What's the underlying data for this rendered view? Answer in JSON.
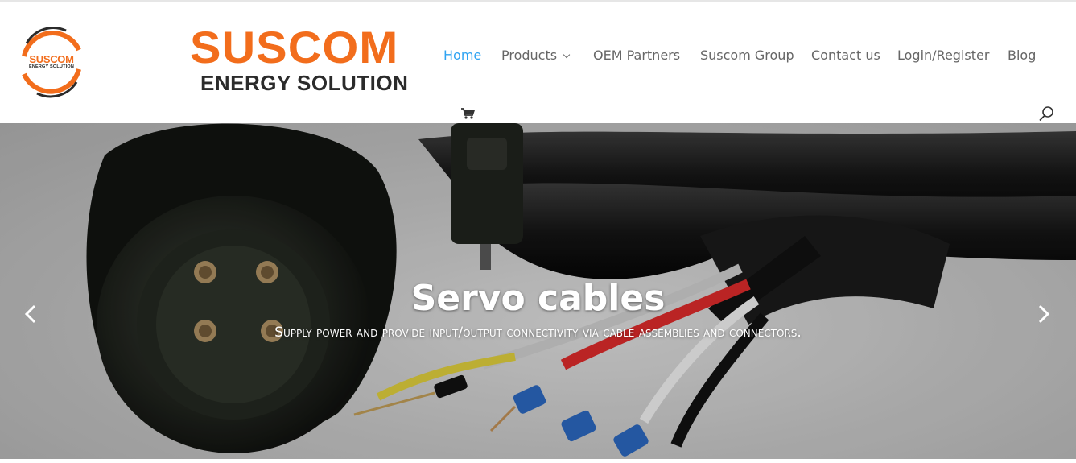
{
  "brand": {
    "badge_title": "SUSCOM",
    "badge_subtitle": "ENERGY SOLUTION",
    "wordmark_title": "SUSCOM",
    "wordmark_subtitle": "ENERGY SOLUTION",
    "orange": "#f26d1c",
    "dark": "#2b2b2b"
  },
  "nav": {
    "items": [
      {
        "label": "Home",
        "active": true
      },
      {
        "label": "Products",
        "has_dropdown": true
      },
      {
        "label": "OEM Partners"
      },
      {
        "label": "Suscom Group"
      },
      {
        "label": "Contact us"
      },
      {
        "label": "Login/Register"
      },
      {
        "label": "Blog"
      }
    ],
    "active_color": "#2ea3f2",
    "text_color": "#666666",
    "icons": [
      "cart-icon",
      "search-icon"
    ]
  },
  "hero": {
    "title": "Servo cables",
    "subtitle": "Supply power and provide input/output connectivity via cable assemblies and connectors.",
    "prev_icon": "chevron-left-icon",
    "next_icon": "chevron-right-icon"
  }
}
